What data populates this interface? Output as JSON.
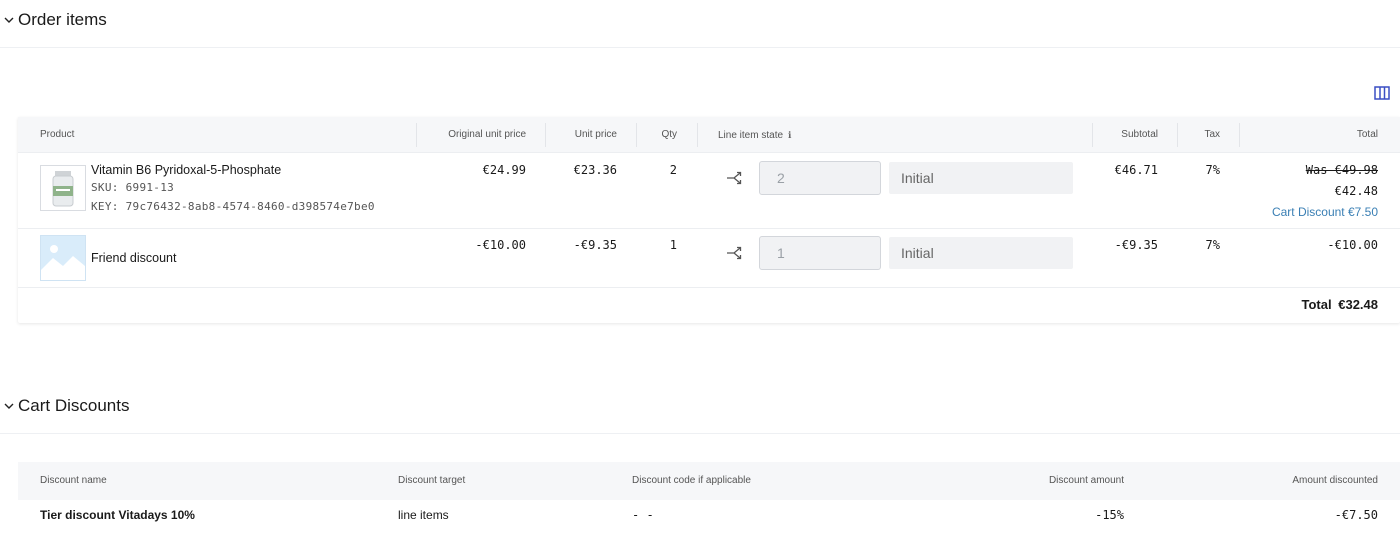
{
  "order_items": {
    "title": "Order items",
    "columns": {
      "product": "Product",
      "original_unit_price": "Original unit price",
      "unit_price": "Unit price",
      "qty": "Qty",
      "line_item_state": "Line item state",
      "subtotal": "Subtotal",
      "tax": "Tax",
      "total": "Total"
    },
    "rows": [
      {
        "name": "Vitamin B6 Pyridoxal-5-Phosphate",
        "sku": "SKU: 6991-13",
        "key": "KEY: 79c76432-8ab8-4574-8460-d398574e7be0",
        "original_unit_price": "€24.99",
        "unit_price": "€23.36",
        "qty": "2",
        "qty_input": "2",
        "state": "Initial",
        "subtotal": "€46.71",
        "tax": "7%",
        "was_total": "Was €49.98",
        "total": "€42.48",
        "cart_discount": "Cart Discount €7.50"
      },
      {
        "name": "Friend discount",
        "original_unit_price": "-€10.00",
        "unit_price": "-€9.35",
        "qty": "1",
        "qty_input": "1",
        "state": "Initial",
        "subtotal": "-€9.35",
        "tax": "7%",
        "total": "-€10.00"
      }
    ],
    "grand_total_label": "Total",
    "grand_total": "€32.48"
  },
  "cart_discounts": {
    "title": "Cart Discounts",
    "columns": {
      "name": "Discount name",
      "target": "Discount target",
      "code": "Discount code if applicable",
      "amount": "Discount amount",
      "discounted": "Amount discounted"
    },
    "rows": [
      {
        "name": "Tier discount Vitadays 10%",
        "target": "line items",
        "code": "- -",
        "amount": "-15%",
        "discounted": "-€7.50"
      }
    ]
  },
  "colors": {
    "accent": "#3a4fc4",
    "link": "#3a7fb4",
    "header_bg": "#f6f7f9"
  },
  "icons": [
    "chevron-down-icon",
    "columns-icon",
    "info-icon",
    "split-icon",
    "product-thumbnail",
    "image-placeholder-icon"
  ]
}
